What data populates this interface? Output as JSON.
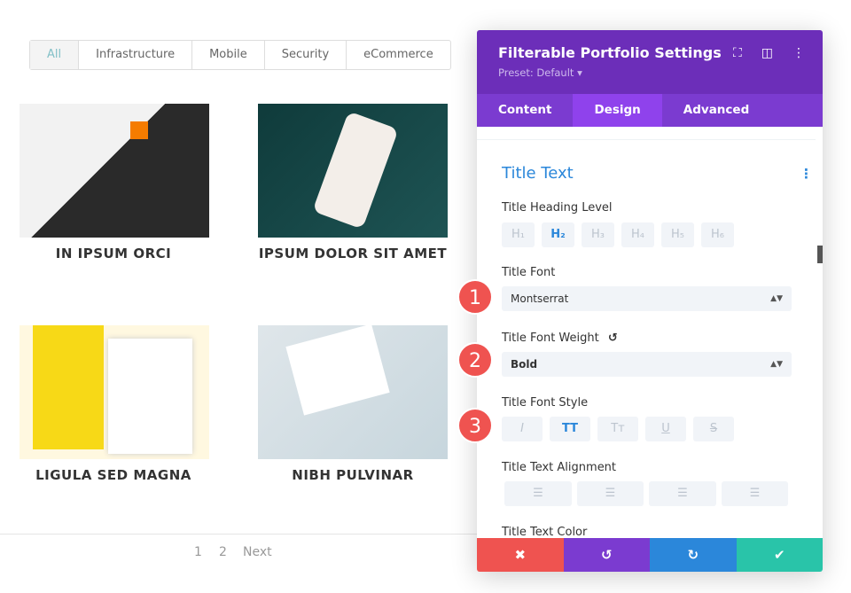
{
  "filters": [
    "All",
    "Infrastructure",
    "Mobile",
    "Security",
    "eCommerce"
  ],
  "portfolio": [
    {
      "title": "IN IPSUM ORCI"
    },
    {
      "title": "IPSUM DOLOR SIT AMET"
    },
    {
      "title": "LIGULA SED MAGNA"
    },
    {
      "title": "NIBH PULVINAR"
    }
  ],
  "pagination": {
    "p1": "1",
    "p2": "2",
    "next": "Next"
  },
  "panel": {
    "title": "Filterable Portfolio Settings",
    "preset": "Preset: Default ▾",
    "tabs": [
      "Content",
      "Design",
      "Advanced"
    ],
    "section": "Title Text",
    "heading_label": "Title Heading Level",
    "headings": [
      "H₁",
      "H₂",
      "H₃",
      "H₄",
      "H₅",
      "H₆"
    ],
    "font_label": "Title Font",
    "font_value": "Montserrat",
    "weight_label": "Title Font Weight",
    "weight_value": "Bold",
    "style_label": "Title Font Style",
    "styles": [
      "I",
      "TT",
      "Tт",
      "U",
      "S"
    ],
    "align_label": "Title Text Alignment",
    "color_label": "Title Text Color"
  },
  "badges": [
    "1",
    "2",
    "3"
  ],
  "colors": {
    "header": "#6c2eb9",
    "tabs": "#7b3bd0",
    "active_tab": "#8f42ec",
    "accent": "#2b87da",
    "cancel": "#ef5350",
    "undo": "#7b3bd0",
    "redo": "#2b87da",
    "save": "#29c4a9"
  }
}
